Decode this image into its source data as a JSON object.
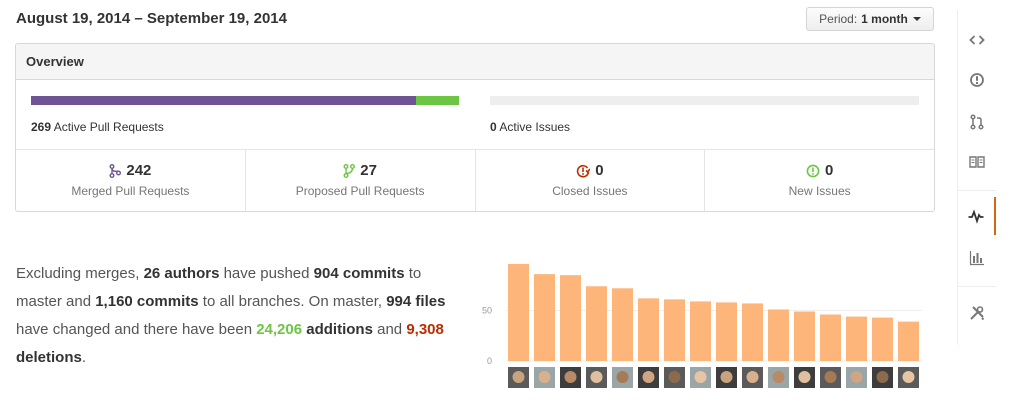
{
  "header": {
    "date_range": "August 19, 2014 – September 19, 2014",
    "period_label": "Period:",
    "period_value": "1 month"
  },
  "overview": {
    "title": "Overview",
    "pull_requests": {
      "count": "269",
      "label": "Active Pull Requests",
      "merged_fraction": 0.9,
      "proposed_fraction": 0.1
    },
    "issues": {
      "count": "0",
      "label": "Active Issues",
      "closed_fraction": 0,
      "open_fraction": 0
    },
    "stats": [
      {
        "num": "242",
        "label": "Merged Pull Requests",
        "icon": "merged-pr-icon"
      },
      {
        "num": "27",
        "label": "Proposed Pull Requests",
        "icon": "proposed-pr-icon"
      },
      {
        "num": "0",
        "label": "Closed Issues",
        "icon": "closed-issue-icon"
      },
      {
        "num": "0",
        "label": "New Issues",
        "icon": "new-issue-icon"
      }
    ]
  },
  "commit_summary": {
    "t1": "Excluding merges, ",
    "authors": "26 authors",
    "t2": " have pushed ",
    "master_commits": "904 commits",
    "t3": " to master and ",
    "all_commits": "1,160 commits",
    "t4": " to all branches. On master, ",
    "files_num": "994",
    "files_word": " files",
    "t5": " have changed and there have been ",
    "additions_num": "24,206",
    "additions_word": " additions",
    "t6": " and ",
    "deletions_num": "9,308",
    "deletions_word": " deletions",
    "t7": "."
  },
  "colors": {
    "merged": "#6e5494",
    "proposed": "#6cc644",
    "closed": "#bd2c00",
    "bar": "#fdb57a",
    "active_tab": "#d26911"
  },
  "chart_data": {
    "type": "bar",
    "categories": [
      "1",
      "2",
      "3",
      "4",
      "5",
      "6",
      "7",
      "8",
      "9",
      "10",
      "11",
      "12",
      "13",
      "14",
      "15",
      "16"
    ],
    "values": [
      96,
      86,
      85,
      74,
      72,
      62,
      61,
      59,
      58,
      57,
      51,
      49,
      46,
      44,
      43,
      39
    ],
    "yticks": [
      "0",
      "50"
    ],
    "ylim": [
      0,
      100
    ],
    "grid": true,
    "xlabel": "",
    "ylabel": ""
  },
  "sidenav": [
    {
      "name": "code-icon",
      "active": false
    },
    {
      "name": "issues-icon",
      "active": false
    },
    {
      "name": "pull-requests-icon",
      "active": false
    },
    {
      "name": "wiki-icon",
      "active": false
    },
    {
      "name": "pulse-icon",
      "active": true
    },
    {
      "name": "graphs-icon",
      "active": false
    },
    {
      "name": "settings-icon",
      "active": false
    }
  ]
}
